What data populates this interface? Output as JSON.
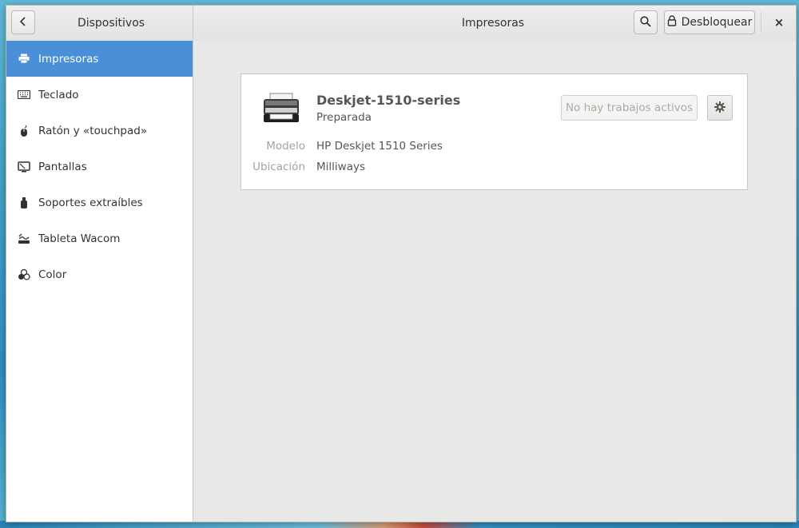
{
  "headerbar": {
    "sidebar_title": "Dispositivos",
    "main_title": "Impresoras",
    "unlock_label": "Desbloquear",
    "close_glyph": "×",
    "back_glyph": "‹"
  },
  "sidebar": {
    "items": [
      {
        "label": "Impresoras",
        "icon": "printer-icon",
        "selected": true
      },
      {
        "label": "Teclado",
        "icon": "keyboard-icon"
      },
      {
        "label": "Ratón y «touchpad»",
        "icon": "mouse-icon"
      },
      {
        "label": "Pantallas",
        "icon": "display-icon"
      },
      {
        "label": "Soportes extraíbles",
        "icon": "usb-drive-icon"
      },
      {
        "label": "Tableta Wacom",
        "icon": "tablet-icon"
      },
      {
        "label": "Color",
        "icon": "color-icon"
      }
    ]
  },
  "printer": {
    "name": "Deskjet-1510-series",
    "status": "Preparada",
    "jobs_button": "No hay trabajos activos",
    "model_label": "Modelo",
    "model_value": "HP Deskjet 1510 Series",
    "location_label": "Ubicación",
    "location_value": "Milliways"
  },
  "colors": {
    "accent": "#4a90d9",
    "text": "#2e3436",
    "muted": "#a1a39f"
  }
}
